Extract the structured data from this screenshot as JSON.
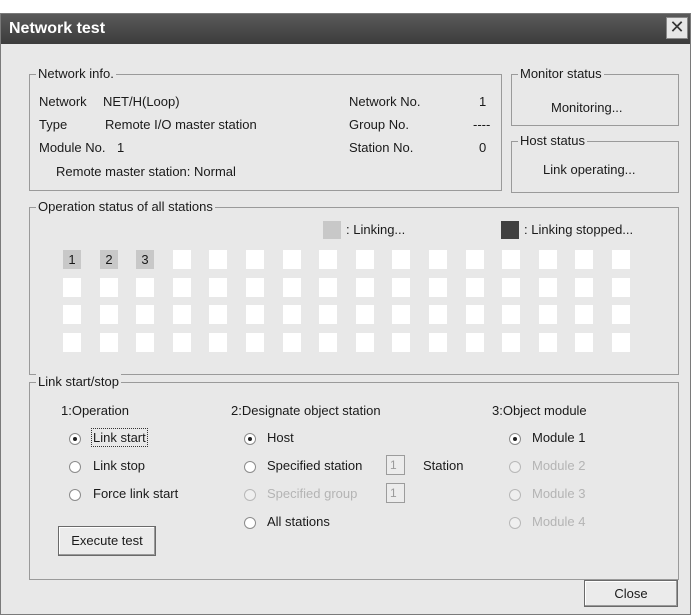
{
  "window": {
    "title": "Network test",
    "close_glyph": "✕"
  },
  "network_info": {
    "caption": "Network info.",
    "network_label": "Network",
    "network_value": "NET/H(Loop)",
    "type_label": "Type",
    "type_value": "Remote I/O master station",
    "module_label": "Module No.",
    "module_value": "1",
    "remote_status": "Remote master station: Normal",
    "network_no_label": "Network No.",
    "network_no_value": "1",
    "group_no_label": "Group No.",
    "group_no_value": "----",
    "station_no_label": "Station No.",
    "station_no_value": "0"
  },
  "monitor": {
    "caption": "Monitor status",
    "value": "Monitoring..."
  },
  "host": {
    "caption": "Host status",
    "value": "Link operating..."
  },
  "stations": {
    "caption": "Operation status of all stations",
    "legend_linking": ": Linking...",
    "legend_stopped": ": Linking stopped...",
    "linking_color": "#c8c8c8",
    "stopped_color": "#404040",
    "labels": [
      "1",
      "2",
      "3"
    ],
    "rows": 4,
    "cols": 16
  },
  "link": {
    "caption": "Link start/stop",
    "operation": {
      "title": "1:Operation",
      "options": [
        "Link start",
        "Link stop",
        "Force link start"
      ],
      "selected": 0
    },
    "object_station": {
      "title": "2:Designate object station",
      "host": "Host",
      "specified_station": "Specified station",
      "station_value": "1",
      "station_suffix": "Station",
      "specified_group": "Specified group",
      "group_value": "1",
      "all_stations": "All stations",
      "selected": "Host"
    },
    "object_module": {
      "title": "3:Object module",
      "options": [
        "Module 1",
        "Module 2",
        "Module 3",
        "Module 4"
      ],
      "selected": 0
    },
    "execute": "Execute test"
  },
  "close_button": "Close"
}
